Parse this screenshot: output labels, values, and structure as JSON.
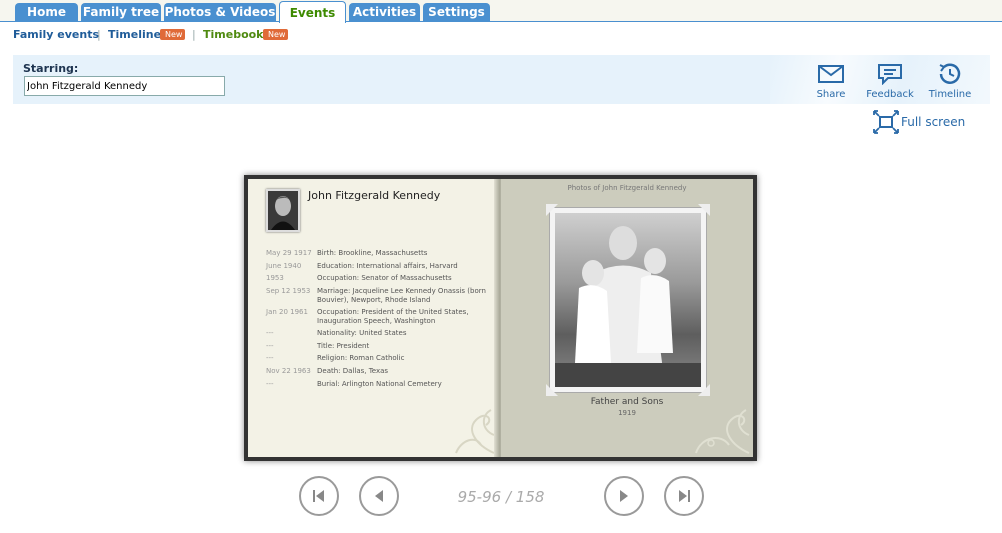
{
  "tabs": [
    {
      "label": "Home"
    },
    {
      "label": "Family tree"
    },
    {
      "label": "Photos & Videos"
    },
    {
      "label": "Events",
      "active": true
    },
    {
      "label": "Activities"
    },
    {
      "label": "Settings"
    }
  ],
  "subnav": {
    "family_events": "Family events",
    "timeline": "Timeline",
    "timebook": "Timebook",
    "new_badge": "New",
    "separator": "|"
  },
  "starring": {
    "label": "Starring:",
    "value": "John Fitzgerald Kennedy"
  },
  "tools": {
    "share": "Share",
    "feedback": "Feedback",
    "timeline": "Timeline",
    "full_screen": "Full screen"
  },
  "book": {
    "person_name": "John Fitzgerald Kennedy",
    "events": [
      {
        "date": "May 29 1917",
        "text": "Birth: Brookline, Massachusetts"
      },
      {
        "date": "June 1940",
        "text": "Education: International affairs, Harvard"
      },
      {
        "date": "1953",
        "text": "Occupation: Senator of Massachusetts"
      },
      {
        "date": "Sep 12 1953",
        "text": "Marriage:  Jacqueline Lee Kennedy Onassis (born Bouvier), Newport, Rhode Island"
      },
      {
        "date": "Jan 20 1961",
        "text": "Occupation: President of the United States, Inauguration Speech, Washington"
      },
      {
        "date": "---",
        "text": "Nationality: United States"
      },
      {
        "date": "---",
        "text": "Title: President"
      },
      {
        "date": "---",
        "text": "Religion: Roman Catholic"
      },
      {
        "date": "Nov 22 1963",
        "text": "Death: Dallas, Texas"
      },
      {
        "date": "---",
        "text": "Burial: Arlington National Cemetery"
      }
    ],
    "photos_title": "Photos of John Fitzgerald Kennedy",
    "photo_caption": "Father and Sons",
    "photo_year": "1919"
  },
  "pager": {
    "text": "95-96 / 158"
  },
  "colors": {
    "tab_blue": "#4a90d0",
    "active_green": "#3d8a00",
    "link_blue": "#1f5c99",
    "badge": "#e06a38"
  }
}
